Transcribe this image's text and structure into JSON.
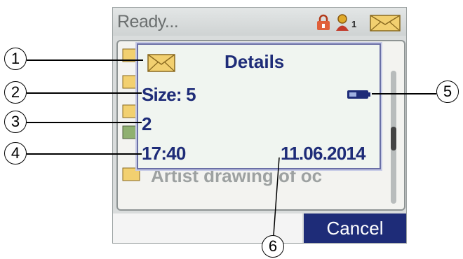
{
  "status": {
    "text": "Ready...",
    "user_count": "1"
  },
  "dialog": {
    "title": "Details",
    "size": "Size: 5",
    "count": "2",
    "time": "17:40",
    "date": "11.06.2014"
  },
  "background_list": {
    "visible_text": "Artist drawing of oc"
  },
  "softkeys": {
    "right": "Cancel"
  },
  "callouts": [
    "1",
    "2",
    "3",
    "4",
    "5",
    "6"
  ],
  "colors": {
    "dialog_text": "#1e2c78",
    "cancel_bg": "#1e2c78",
    "screen_bg": "#d9dcdc"
  },
  "icons": [
    "lock-icon",
    "user-icon",
    "mail-icon",
    "battery-icon"
  ]
}
